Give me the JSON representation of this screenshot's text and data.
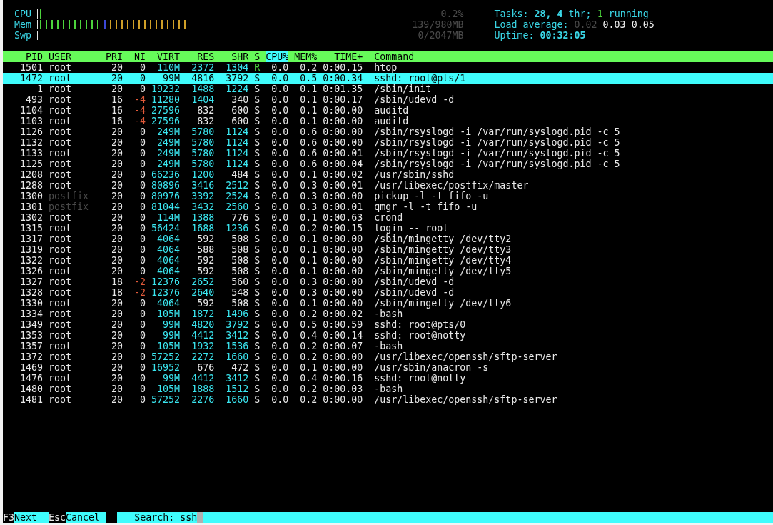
{
  "meters": [
    {
      "label": "Mem",
      "reading": "139/980MB",
      "segments": [
        {
          "kind": "used",
          "level": 0.15
        },
        {
          "kind": "buffers",
          "level": 0.013
        },
        {
          "kind": "cache",
          "level": 0.19
        }
      ]
    },
    {
      "label": "Swp",
      "reading": "0/2047MB"
    }
  ],
  "cpu_meter": {
    "label": "CPU",
    "reading": "0.2%",
    "segments": [
      {
        "kind": "normal",
        "level": 0.013
      }
    ]
  },
  "summary": [
    {
      "parts": [
        {
          "kind": "label",
          "text": "Tasks:"
        },
        {
          "kind": "bright",
          "text": "28,"
        },
        {
          "kind": "bright",
          "text": "4"
        },
        {
          "kind": "label",
          "text": "thr;"
        },
        {
          "kind": "running",
          "text": "1"
        },
        {
          "kind": "label",
          "text": "running"
        }
      ]
    },
    {
      "parts": [
        {
          "kind": "label",
          "text": "Load average:"
        },
        {
          "kind": "dim",
          "text": "0.02"
        },
        {
          "kind": "value",
          "text": "0.03"
        },
        {
          "kind": "value",
          "text": "0.05"
        }
      ]
    },
    {
      "parts": [
        {
          "kind": "label",
          "text": "Uptime:"
        },
        {
          "kind": "bright",
          "text": "00:32:05"
        }
      ]
    }
  ],
  "table": {
    "columns": [
      {
        "label": "PID",
        "sorted": false
      },
      {
        "label": "USER",
        "sorted": false
      },
      {
        "label": "PRI",
        "sorted": false
      },
      {
        "label": "NI",
        "sorted": false
      },
      {
        "label": "VIRT",
        "sorted": false
      },
      {
        "label": "RES",
        "sorted": false
      },
      {
        "label": "SHR",
        "sorted": false
      },
      {
        "label": "S",
        "sorted": false
      },
      {
        "label": "CPU%",
        "sorted": true
      },
      {
        "label": "MEM%",
        "sorted": false
      },
      {
        "label": "TIME+",
        "sorted": false
      },
      {
        "label": "Command",
        "sorted": false
      }
    ],
    "rows": [
      {
        "cells": [
          "1501",
          "root",
          "20",
          "0",
          "110M",
          "2372",
          "1304",
          "R",
          "0.0",
          "0.2",
          "0:00.15",
          "htop"
        ],
        "selected": false,
        "running": true,
        "dim_user": false,
        "negative_nice": false
      },
      {
        "cells": [
          "1472",
          "root",
          "20",
          "0",
          "99M",
          "4816",
          "3792",
          "S",
          "0.0",
          "0.5",
          "0:00.34",
          "sshd: root@pts/1"
        ],
        "selected": true
      },
      {
        "cells": [
          "1",
          "root",
          "20",
          "0",
          "19232",
          "1488",
          "1224",
          "S",
          "0.0",
          "0.1",
          "0:01.35",
          "/sbin/init"
        ],
        "selected": false,
        "running": false,
        "dim_user": false,
        "negative_nice": false
      },
      {
        "cells": [
          "493",
          "root",
          "16",
          "-4",
          "11280",
          "1404",
          "340",
          "S",
          "0.0",
          "0.1",
          "0:00.17",
          "/sbin/udevd -d"
        ],
        "selected": false,
        "running": false,
        "dim_user": false,
        "negative_nice": true
      },
      {
        "cells": [
          "1104",
          "root",
          "16",
          "-4",
          "27596",
          "832",
          "600",
          "S",
          "0.0",
          "0.1",
          "0:00.00",
          "auditd"
        ],
        "selected": false,
        "running": false,
        "dim_user": false,
        "negative_nice": true
      },
      {
        "cells": [
          "1103",
          "root",
          "16",
          "-4",
          "27596",
          "832",
          "600",
          "S",
          "0.0",
          "0.1",
          "0:00.00",
          "auditd"
        ],
        "selected": false,
        "running": false,
        "dim_user": false,
        "negative_nice": true
      },
      {
        "cells": [
          "1126",
          "root",
          "20",
          "0",
          "249M",
          "5780",
          "1124",
          "S",
          "0.0",
          "0.6",
          "0:00.00",
          "/sbin/rsyslogd -i /var/run/syslogd.pid -c 5"
        ],
        "selected": false,
        "running": false,
        "dim_user": false,
        "negative_nice": false
      },
      {
        "cells": [
          "1132",
          "root",
          "20",
          "0",
          "249M",
          "5780",
          "1124",
          "S",
          "0.0",
          "0.6",
          "0:00.00",
          "/sbin/rsyslogd -i /var/run/syslogd.pid -c 5"
        ],
        "selected": false,
        "running": false,
        "dim_user": false,
        "negative_nice": false
      },
      {
        "cells": [
          "1133",
          "root",
          "20",
          "0",
          "249M",
          "5780",
          "1124",
          "S",
          "0.0",
          "0.6",
          "0:00.01",
          "/sbin/rsyslogd -i /var/run/syslogd.pid -c 5"
        ],
        "selected": false,
        "running": false,
        "dim_user": false,
        "negative_nice": false
      },
      {
        "cells": [
          "1125",
          "root",
          "20",
          "0",
          "249M",
          "5780",
          "1124",
          "S",
          "0.0",
          "0.6",
          "0:00.04",
          "/sbin/rsyslogd -i /var/run/syslogd.pid -c 5"
        ],
        "selected": false,
        "running": false,
        "dim_user": false,
        "negative_nice": false
      },
      {
        "cells": [
          "1208",
          "root",
          "20",
          "0",
          "66236",
          "1200",
          "484",
          "S",
          "0.0",
          "0.1",
          "0:00.02",
          "/usr/sbin/sshd"
        ],
        "selected": false,
        "running": false,
        "dim_user": false,
        "negative_nice": false
      },
      {
        "cells": [
          "1288",
          "root",
          "20",
          "0",
          "80896",
          "3416",
          "2512",
          "S",
          "0.0",
          "0.3",
          "0:00.01",
          "/usr/libexec/postfix/master"
        ],
        "selected": false,
        "running": false,
        "dim_user": false,
        "negative_nice": false
      },
      {
        "cells": [
          "1300",
          "postfix",
          "20",
          "0",
          "80976",
          "3392",
          "2524",
          "S",
          "0.0",
          "0.3",
          "0:00.00",
          "pickup -l -t fifo -u"
        ],
        "selected": false,
        "running": false,
        "dim_user": true,
        "negative_nice": false
      },
      {
        "cells": [
          "1301",
          "postfix",
          "20",
          "0",
          "81044",
          "3432",
          "2560",
          "S",
          "0.0",
          "0.3",
          "0:00.01",
          "qmgr -l -t fifo -u"
        ],
        "selected": false,
        "running": false,
        "dim_user": true,
        "negative_nice": false
      },
      {
        "cells": [
          "1302",
          "root",
          "20",
          "0",
          "114M",
          "1388",
          "776",
          "S",
          "0.0",
          "0.1",
          "0:00.63",
          "crond"
        ],
        "selected": false,
        "running": false,
        "dim_user": false,
        "negative_nice": false
      },
      {
        "cells": [
          "1315",
          "root",
          "20",
          "0",
          "56424",
          "1688",
          "1236",
          "S",
          "0.0",
          "0.2",
          "0:00.15",
          "login -- root"
        ],
        "selected": false,
        "running": false,
        "dim_user": false,
        "negative_nice": false
      },
      {
        "cells": [
          "1317",
          "root",
          "20",
          "0",
          "4064",
          "592",
          "508",
          "S",
          "0.0",
          "0.1",
          "0:00.00",
          "/sbin/mingetty /dev/tty2"
        ],
        "selected": false,
        "running": false,
        "dim_user": false,
        "negative_nice": false
      },
      {
        "cells": [
          "1319",
          "root",
          "20",
          "0",
          "4064",
          "588",
          "508",
          "S",
          "0.0",
          "0.1",
          "0:00.00",
          "/sbin/mingetty /dev/tty3"
        ],
        "selected": false,
        "running": false,
        "dim_user": false,
        "negative_nice": false
      },
      {
        "cells": [
          "1322",
          "root",
          "20",
          "0",
          "4064",
          "592",
          "508",
          "S",
          "0.0",
          "0.1",
          "0:00.00",
          "/sbin/mingetty /dev/tty4"
        ],
        "selected": false,
        "running": false,
        "dim_user": false,
        "negative_nice": false
      },
      {
        "cells": [
          "1326",
          "root",
          "20",
          "0",
          "4064",
          "592",
          "508",
          "S",
          "0.0",
          "0.1",
          "0:00.00",
          "/sbin/mingetty /dev/tty5"
        ],
        "selected": false,
        "running": false,
        "dim_user": false,
        "negative_nice": false
      },
      {
        "cells": [
          "1327",
          "root",
          "18",
          "-2",
          "12376",
          "2652",
          "560",
          "S",
          "0.0",
          "0.3",
          "0:00.00",
          "/sbin/udevd -d"
        ],
        "selected": false,
        "running": false,
        "dim_user": false,
        "negative_nice": true
      },
      {
        "cells": [
          "1328",
          "root",
          "18",
          "-2",
          "12376",
          "2640",
          "548",
          "S",
          "0.0",
          "0.3",
          "0:00.00",
          "/sbin/udevd -d"
        ],
        "selected": false,
        "running": false,
        "dim_user": false,
        "negative_nice": true
      },
      {
        "cells": [
          "1330",
          "root",
          "20",
          "0",
          "4064",
          "592",
          "508",
          "S",
          "0.0",
          "0.1",
          "0:00.00",
          "/sbin/mingetty /dev/tty6"
        ],
        "selected": false,
        "running": false,
        "dim_user": false,
        "negative_nice": false
      },
      {
        "cells": [
          "1334",
          "root",
          "20",
          "0",
          "105M",
          "1872",
          "1496",
          "S",
          "0.0",
          "0.2",
          "0:00.02",
          "-bash"
        ],
        "selected": false,
        "running": false,
        "dim_user": false,
        "negative_nice": false
      },
      {
        "cells": [
          "1349",
          "root",
          "20",
          "0",
          "99M",
          "4820",
          "3792",
          "S",
          "0.0",
          "0.5",
          "0:00.59",
          "sshd: root@pts/0"
        ],
        "selected": false,
        "running": false,
        "dim_user": false,
        "negative_nice": false
      },
      {
        "cells": [
          "1353",
          "root",
          "20",
          "0",
          "99M",
          "4412",
          "3412",
          "S",
          "0.0",
          "0.4",
          "0:00.14",
          "sshd: root@notty"
        ],
        "selected": false,
        "running": false,
        "dim_user": false,
        "negative_nice": false
      },
      {
        "cells": [
          "1357",
          "root",
          "20",
          "0",
          "105M",
          "1932",
          "1536",
          "S",
          "0.0",
          "0.2",
          "0:00.07",
          "-bash"
        ],
        "selected": false,
        "running": false,
        "dim_user": false,
        "negative_nice": false
      },
      {
        "cells": [
          "1372",
          "root",
          "20",
          "0",
          "57252",
          "2272",
          "1660",
          "S",
          "0.0",
          "0.2",
          "0:00.00",
          "/usr/libexec/openssh/sftp-server"
        ],
        "selected": false,
        "running": false,
        "dim_user": false,
        "negative_nice": false
      },
      {
        "cells": [
          "1469",
          "root",
          "20",
          "0",
          "16952",
          "676",
          "472",
          "S",
          "0.0",
          "0.1",
          "0:00.00",
          "/usr/sbin/anacron -s"
        ],
        "selected": false,
        "running": false,
        "dim_user": false,
        "negative_nice": false
      },
      {
        "cells": [
          "1476",
          "root",
          "20",
          "0",
          "99M",
          "4412",
          "3412",
          "S",
          "0.0",
          "0.4",
          "0:00.16",
          "sshd: root@notty"
        ],
        "selected": false,
        "running": false,
        "dim_user": false,
        "negative_nice": false
      },
      {
        "cells": [
          "1480",
          "root",
          "20",
          "0",
          "105M",
          "1888",
          "1512",
          "S",
          "0.0",
          "0.2",
          "0:00.03",
          "-bash"
        ],
        "selected": false,
        "running": false,
        "dim_user": false,
        "negative_nice": false
      },
      {
        "cells": [
          "1481",
          "root",
          "20",
          "0",
          "57252",
          "2276",
          "1660",
          "S",
          "0.0",
          "0.2",
          "0:00.00",
          "/usr/libexec/openssh/sftp-server"
        ],
        "selected": false,
        "running": false,
        "dim_user": false,
        "negative_nice": false
      }
    ]
  },
  "footer": {
    "keys": [
      {
        "key": "F3",
        "label": "Next"
      },
      {
        "key": "Esc",
        "label": "Cancel"
      }
    ],
    "search": {
      "label": "Search:",
      "value": "ssh"
    }
  }
}
